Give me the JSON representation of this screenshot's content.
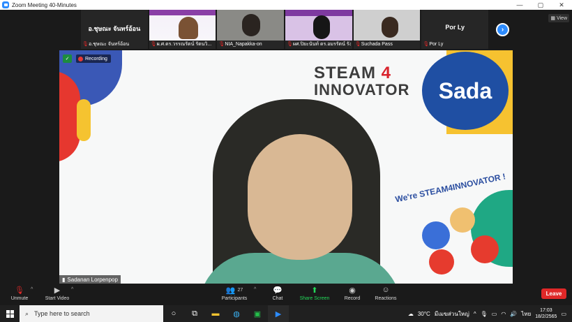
{
  "window": {
    "title": "Zoom Meeting 40-Minutes",
    "controls": [
      "—",
      "▢",
      "✕"
    ]
  },
  "gallery": {
    "left_tile": {
      "display_name": "อ.ชุษณะ จันทร์อ้อน",
      "label": "อ.ชุษณะ จันทร์อ้อน"
    },
    "tiles": [
      {
        "label": "ผ.ศ.ดร.วรรณรัตน์ รัตนวิ..."
      },
      {
        "label": "NIA_Napakka-on"
      },
      {
        "label": "ผศ.ปิยะนันท์ ดร.อมรรัตน์ รัง..."
      },
      {
        "label": "Suchada Pass"
      }
    ],
    "right_tile": {
      "display_name": "Por Ly",
      "label": "Por Ly"
    },
    "next_icon": "chevron-right",
    "view_label": "View"
  },
  "main_video": {
    "recording_label": "Recording",
    "speaker_name": "Sadanan Lorpenpop",
    "background": {
      "logo_line1": "STEAM",
      "logo_number": "4",
      "logo_line2": "INNOVATOR",
      "brand": "Sada",
      "tagline": "We're STEAM4INNOVATOR !"
    }
  },
  "toolbar": {
    "unmute": "Unmute",
    "start_video": "Start Video",
    "participants": "Participants",
    "participant_count": "27",
    "chat": "Chat",
    "share_screen": "Share Screen",
    "record": "Record",
    "reactions": "Reactions",
    "leave": "Leave"
  },
  "taskbar": {
    "search_placeholder": "Type here to search",
    "weather": "30°C",
    "weather_desc": "มีเมฆส่วนใหญ่",
    "language": "ไทย",
    "time": "17:03",
    "date": "18/2/2565"
  },
  "colors": {
    "zoom_blue": "#2d8cff",
    "leave_red": "#e02828",
    "share_green": "#23d959",
    "recording_red": "#e53935"
  }
}
